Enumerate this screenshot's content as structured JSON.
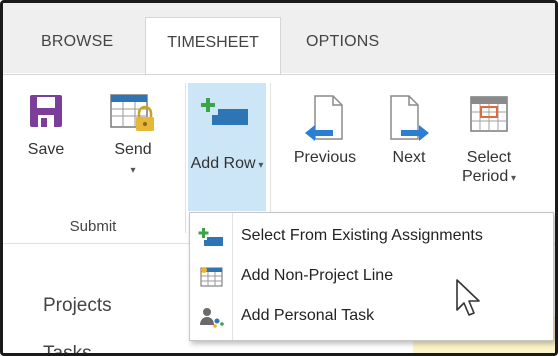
{
  "tabs": [
    {
      "label": "BROWSE",
      "active": false
    },
    {
      "label": "TIMESHEET",
      "active": true
    },
    {
      "label": "OPTIONS",
      "active": false
    }
  ],
  "ribbon": {
    "submit_group": {
      "label": "Submit",
      "save": {
        "label": "Save",
        "icon": "save-icon"
      },
      "send": {
        "label": "Send",
        "icon": "send-lock-icon"
      }
    },
    "add_row": {
      "label_line1": "Add",
      "label_line2": "Row",
      "icon": "add-row-icon"
    },
    "previous": {
      "label": "Previous",
      "icon": "previous-period-icon"
    },
    "next": {
      "label": "Next",
      "icon": "next-period-icon"
    },
    "select_period": {
      "label_line1": "Select",
      "label_line2": "Period",
      "icon": "calendar-icon"
    }
  },
  "add_row_menu": {
    "items": [
      {
        "label": "Select From Existing Assignments",
        "icon": "existing-assignments-icon"
      },
      {
        "label": "Add Non-Project Line",
        "icon": "non-project-line-icon"
      },
      {
        "label": "Add Personal Task",
        "icon": "personal-task-icon"
      }
    ]
  },
  "left_nav": {
    "items": [
      {
        "label": "Projects"
      },
      {
        "label": "Tasks"
      }
    ]
  },
  "colors": {
    "accent_purple": "#7b3f99",
    "add_row_highlight": "#cde6f7",
    "arrow_blue": "#2a7fd4",
    "green_plus": "#3aa447",
    "folder_blue": "#2e75b6"
  }
}
